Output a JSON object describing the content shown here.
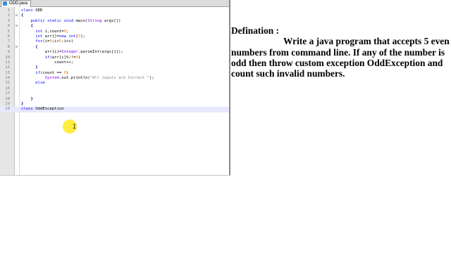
{
  "editor": {
    "tab_label": "ODD.java",
    "lines": [
      {
        "n": "1",
        "fold": "",
        "tokens": [
          {
            "c": "kw",
            "t": "class "
          },
          {
            "c": "plain",
            "t": "ODD"
          }
        ]
      },
      {
        "n": "2",
        "fold": "⊟",
        "tokens": [
          {
            "c": "op",
            "t": "{"
          }
        ]
      },
      {
        "n": "3",
        "fold": "",
        "tokens": [
          {
            "c": "plain",
            "t": "    "
          },
          {
            "c": "kw",
            "t": "public static void "
          },
          {
            "c": "plain",
            "t": "main("
          },
          {
            "c": "ty",
            "t": "String"
          },
          {
            "c": "plain",
            "t": " args[])"
          }
        ]
      },
      {
        "n": "4",
        "fold": "⊟",
        "tokens": [
          {
            "c": "plain",
            "t": "    "
          },
          {
            "c": "op",
            "t": "{"
          }
        ]
      },
      {
        "n": "5",
        "fold": "",
        "tokens": [
          {
            "c": "plain",
            "t": "      "
          },
          {
            "c": "kw",
            "t": "int "
          },
          {
            "c": "plain",
            "t": "i,count="
          },
          {
            "c": "num",
            "t": "0"
          },
          {
            "c": "plain",
            "t": ";"
          }
        ]
      },
      {
        "n": "6",
        "fold": "",
        "tokens": [
          {
            "c": "plain",
            "t": "      "
          },
          {
            "c": "kw",
            "t": "int "
          },
          {
            "c": "plain",
            "t": "arr[]="
          },
          {
            "c": "kw",
            "t": "new int"
          },
          {
            "c": "plain",
            "t": "["
          },
          {
            "c": "num",
            "t": "5"
          },
          {
            "c": "plain",
            "t": "];"
          }
        ]
      },
      {
        "n": "7",
        "fold": "",
        "tokens": [
          {
            "c": "plain",
            "t": "      "
          },
          {
            "c": "kw",
            "t": "for"
          },
          {
            "c": "plain",
            "t": "(i="
          },
          {
            "c": "num",
            "t": "0"
          },
          {
            "c": "plain",
            "t": ";i<"
          },
          {
            "c": "num",
            "t": "5"
          },
          {
            "c": "plain",
            "t": ";i++)"
          }
        ]
      },
      {
        "n": "8",
        "fold": "⊟",
        "tokens": [
          {
            "c": "plain",
            "t": "      "
          },
          {
            "c": "op",
            "t": "{"
          }
        ]
      },
      {
        "n": "9",
        "fold": "",
        "tokens": [
          {
            "c": "plain",
            "t": "          arr[i]="
          },
          {
            "c": "ty",
            "t": "Integer"
          },
          {
            "c": "plain",
            "t": ".parseInt(args[i]);"
          }
        ]
      },
      {
        "n": "10",
        "fold": "",
        "tokens": [
          {
            "c": "plain",
            "t": "          "
          },
          {
            "c": "kw",
            "t": "if"
          },
          {
            "c": "plain",
            "t": "(arr[i]%"
          },
          {
            "c": "num",
            "t": "2"
          },
          {
            "c": "plain",
            "t": "!="
          },
          {
            "c": "num",
            "t": "0"
          },
          {
            "c": "plain",
            "t": ")"
          }
        ]
      },
      {
        "n": "11",
        "fold": "",
        "tokens": [
          {
            "c": "plain",
            "t": "              count++;"
          }
        ]
      },
      {
        "n": "12",
        "fold": "",
        "tokens": [
          {
            "c": "plain",
            "t": "      "
          },
          {
            "c": "op",
            "t": "}"
          }
        ]
      },
      {
        "n": "13",
        "fold": "",
        "tokens": [
          {
            "c": "plain",
            "t": "      "
          },
          {
            "c": "kw",
            "t": "if"
          },
          {
            "c": "plain",
            "t": "(count == "
          },
          {
            "c": "num",
            "t": "0"
          },
          {
            "c": "plain",
            "t": ")"
          }
        ]
      },
      {
        "n": "14",
        "fold": "",
        "tokens": [
          {
            "c": "plain",
            "t": "          "
          },
          {
            "c": "ty",
            "t": "System"
          },
          {
            "c": "plain",
            "t": ".out.println("
          },
          {
            "c": "str",
            "t": "\"All inputs are Correct \""
          },
          {
            "c": "plain",
            "t": ");"
          }
        ]
      },
      {
        "n": "15",
        "fold": "",
        "tokens": [
          {
            "c": "plain",
            "t": "      "
          },
          {
            "c": "kw",
            "t": "else"
          }
        ]
      },
      {
        "n": "16",
        "fold": "",
        "tokens": []
      },
      {
        "n": "17",
        "fold": "",
        "tokens": []
      },
      {
        "n": "18",
        "fold": "",
        "tokens": [
          {
            "c": "plain",
            "t": "    "
          },
          {
            "c": "op",
            "t": "}"
          }
        ]
      },
      {
        "n": "19",
        "fold": "",
        "tokens": [
          {
            "c": "op",
            "t": "}"
          }
        ]
      },
      {
        "n": "20",
        "fold": "",
        "tokens": [
          {
            "c": "kw",
            "t": "class "
          },
          {
            "c": "plain",
            "t": "OddException"
          }
        ],
        "active": true
      }
    ]
  },
  "definition": {
    "title": "Defination :",
    "body": "Write a java program that accepts 5 even numbers from command line. If any of the number is odd then throw custom exception OddException and count such invalid numbers."
  }
}
